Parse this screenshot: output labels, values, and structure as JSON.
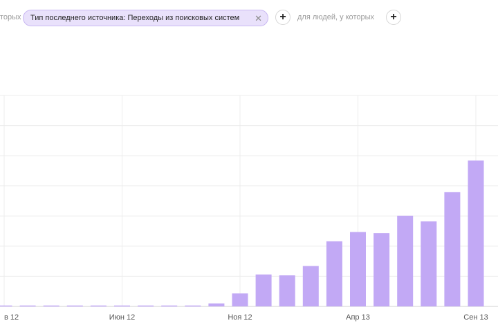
{
  "filters": {
    "left_fragment": "торых",
    "chip_label": "Тип последнего источника: Переходы из поисковых систем",
    "chip_close_icon": "close-icon",
    "add_icon": "plus-icon",
    "people_fragment": "для людей, у которых"
  },
  "chart_data": {
    "type": "bar",
    "color": "#c2a9f5",
    "x_tick_labels": [
      "в 12",
      "Июн 12",
      "Ноя 12",
      "Апр 13",
      "Сен 13"
    ],
    "grid": true,
    "series": [
      {
        "values": [
          0.3,
          0.3,
          0.3,
          0.3,
          0.3,
          0.3,
          0.3,
          0.3,
          0.3,
          1,
          4.3,
          10.6,
          10.3,
          13.4,
          21.6,
          24.7,
          24.3,
          30.1,
          28.2,
          37.9,
          48.4
        ]
      }
    ],
    "ylim": [
      0,
      70
    ]
  }
}
